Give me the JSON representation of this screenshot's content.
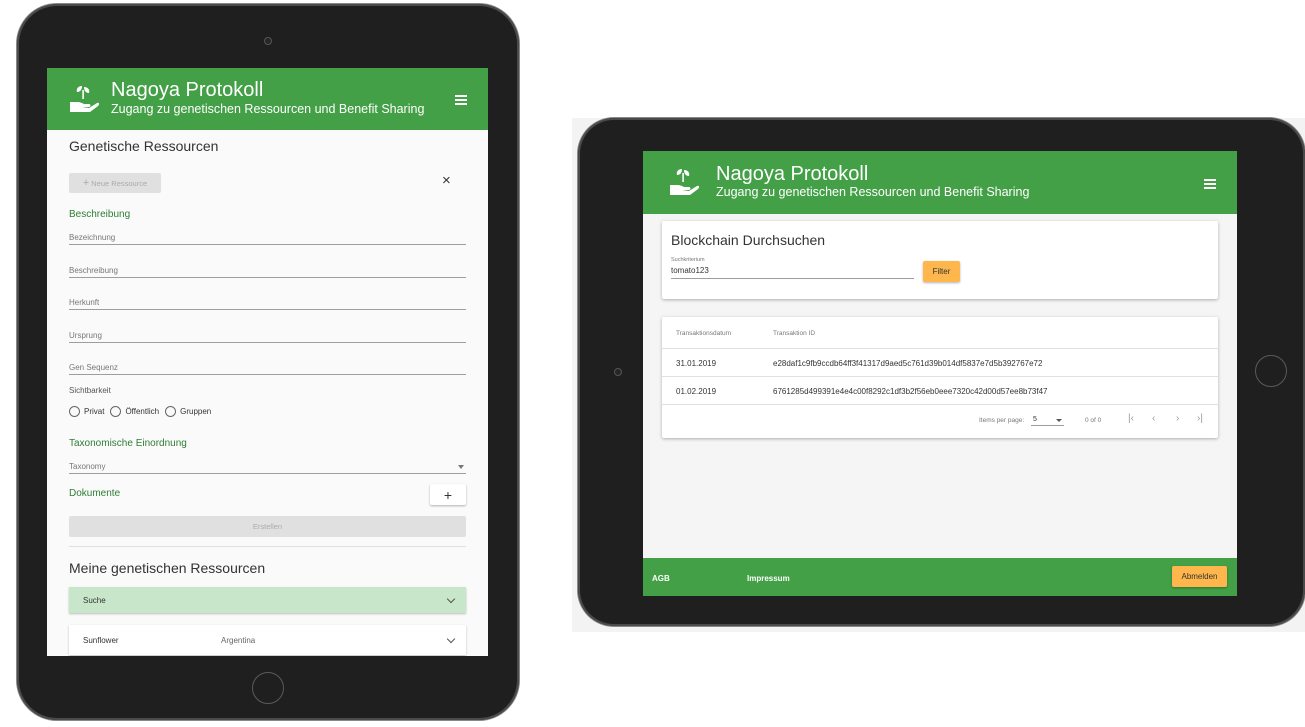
{
  "app": {
    "title": "Nagoya Protokoll",
    "subtitle": "Zugang zu genetischen Ressourcen und Benefit Sharing",
    "brand_color": "#43a047",
    "accent_color": "#ffb74d"
  },
  "left": {
    "section_title": "Genetische Ressourcen",
    "new_resource_button": "Neue Ressource",
    "description_heading": "Beschreibung",
    "fields": {
      "bezeichnung": "Bezeichnung",
      "beschreibung": "Beschreibung",
      "herkunft": "Herkunft",
      "ursprung": "Ursprung",
      "gen_sequenz": "Gen Sequenz"
    },
    "visibility_label": "Sichtbarkeit",
    "visibility_options": [
      "Privat",
      "Öffentlich",
      "Gruppen"
    ],
    "taxonomy_heading": "Taxonomische Einordnung",
    "taxonomy_placeholder": "Taxonomy",
    "documents_heading": "Dokumente",
    "create_button": "Erstellen",
    "my_resources_title": "Meine genetischen Ressourcen",
    "search_panel": "Suche",
    "resources": [
      {
        "name": "Sunflower",
        "origin": "Argentina"
      }
    ]
  },
  "right": {
    "search_title": "Blockchain Durchsuchen",
    "search_label": "Suchkriterium",
    "search_value": "tomato123",
    "filter_button": "Filter",
    "table": {
      "headers": [
        "Transaktionsdatum",
        "Transaktion ID"
      ],
      "rows": [
        [
          "31.01.2019",
          "e28daf1c9fb9ccdb64ff3f41317d9aed5c761d39b014df5837e7d5b392767e72"
        ],
        [
          "01.02.2019",
          "6761285d499391e4e4c00f8292c1df3b2f56eb0eee7320c42d00d57ee8b73f47"
        ]
      ]
    },
    "pager": {
      "items_per_page_label": "Items per page:",
      "items_per_page": "5",
      "range": "0 of 0"
    },
    "footer": {
      "agb": "AGB",
      "impressum": "Impressum",
      "logout": "Abmelden"
    }
  }
}
